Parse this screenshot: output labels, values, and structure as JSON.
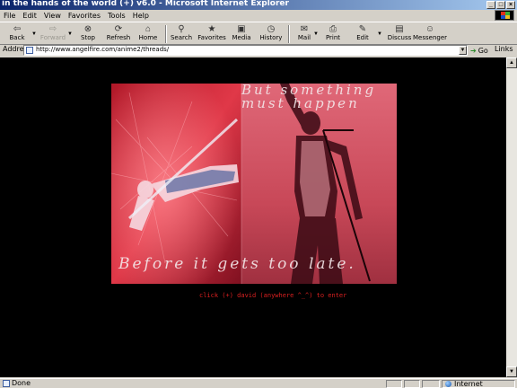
{
  "window": {
    "title": "in the hands of the world (+) v6.0 - Microsoft Internet Explorer",
    "controls": [
      "_",
      "□",
      "×"
    ]
  },
  "menu": [
    "File",
    "Edit",
    "View",
    "Favorites",
    "Tools",
    "Help"
  ],
  "toolbar": {
    "back": "Back",
    "forward": "Forward",
    "stop": "Stop",
    "refresh": "Refresh",
    "home": "Home",
    "search": "Search",
    "favorites": "Favorites",
    "media": "Media",
    "history": "History",
    "mail": "Mail",
    "print": "Print",
    "edit": "Edit",
    "discuss": "Discuss",
    "messenger": "Messenger"
  },
  "address": {
    "label": "Address",
    "url": "http://www.angelfire.com/anime2/threads/",
    "go": "Go",
    "links": "Links"
  },
  "page": {
    "caption_top_line1": "But something",
    "caption_top_line2": "must happen",
    "caption_bottom": "Before it gets too late.",
    "enter_link": "click (+) david (anywhere ^_^) to enter"
  },
  "status": {
    "text": "Done",
    "zone": "Internet"
  }
}
